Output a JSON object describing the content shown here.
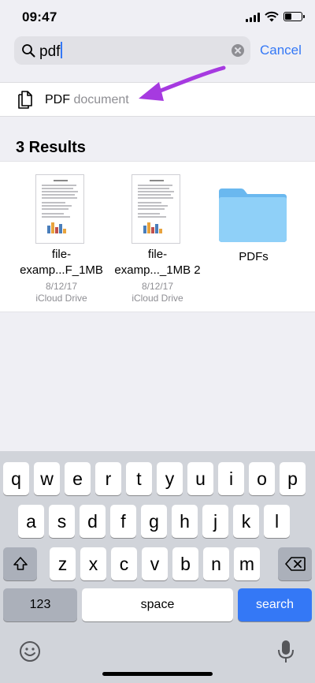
{
  "status": {
    "time": "09:47"
  },
  "search": {
    "query": "pdf",
    "cancel_label": "Cancel"
  },
  "suggestion": {
    "kind": "PDF",
    "type": "document"
  },
  "results": {
    "title": "3 Results",
    "items": [
      {
        "name_line1": "file-",
        "name_line2": "examp...F_1MB",
        "date": "8/12/17",
        "location": "iCloud Drive"
      },
      {
        "name_line1": "file-",
        "name_line2": "examp..._1MB 2",
        "date": "8/12/17",
        "location": "iCloud Drive"
      },
      {
        "name_line1": "PDFs"
      }
    ]
  },
  "keyboard": {
    "row1": [
      "q",
      "w",
      "e",
      "r",
      "t",
      "y",
      "u",
      "i",
      "o",
      "p"
    ],
    "row2": [
      "a",
      "s",
      "d",
      "f",
      "g",
      "h",
      "j",
      "k",
      "l"
    ],
    "row3": [
      "z",
      "x",
      "c",
      "v",
      "b",
      "n",
      "m"
    ],
    "numbers_label": "123",
    "space_label": "space",
    "search_label": "search"
  },
  "colors": {
    "accent": "#3478f6",
    "arrow": "#a63ae0",
    "folder": "#7cc4f5"
  }
}
